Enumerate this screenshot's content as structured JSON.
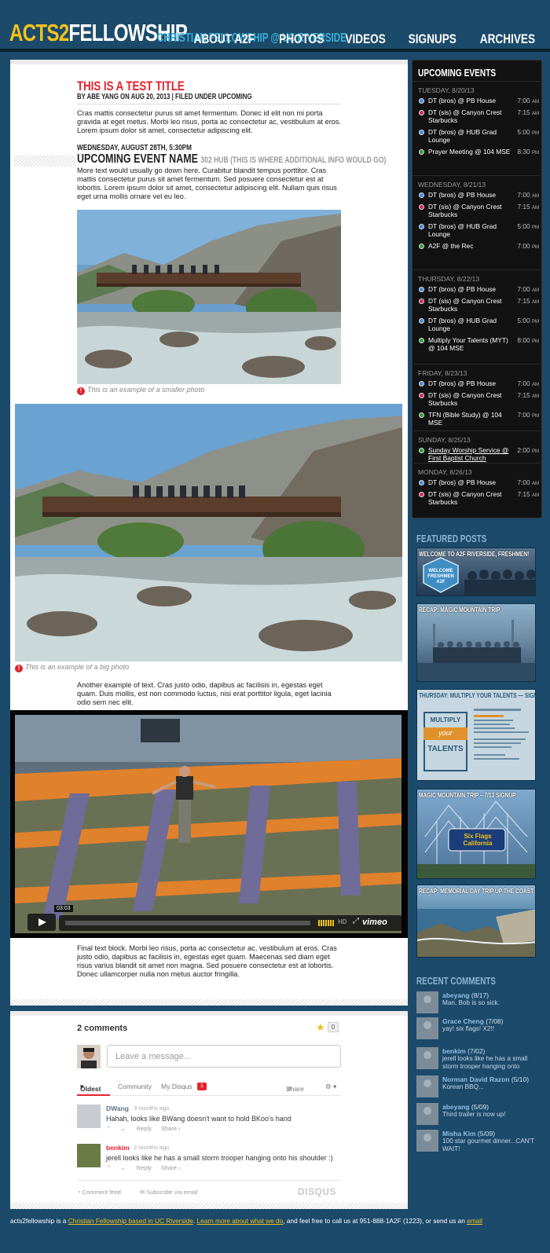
{
  "header": {
    "logo_part1": "ACTS2",
    "logo_part2": "FELLOWSHIP",
    "tagline": "CHRISTIAN FELLOWSHIP @ UC RIVERSIDE",
    "nav": [
      "ABOUT A2F",
      "PHOTOS",
      "VIDEOS",
      "SIGNUPS",
      "ARCHIVES"
    ]
  },
  "post": {
    "title": "THIS IS A TEST TITLE",
    "meta": "BY ABE YANG ON AUG 20, 2013 | FILED UNDER UPCOMING",
    "para1": "Cras mattis consectetur purus sit amet fermentum. Donec id elit non mi porta gravida at eget metus. Morbi leo risus, porta ac consectetur ac, vestibulum at eros. Lorem ipsum dolor sit amet, consectetur adipiscing elit.",
    "event_date": "WEDNESDAY, AUGUST 28TH, 5:30PM",
    "event_name": "UPCOMING EVENT NAME",
    "event_sub": "302 HUB (THIS IS WHERE ADDITIONAL INFO WOULD GO)",
    "para2": "More text would usually go down here. Curabitur blandit tempus porttitor. Cras mattis consectetur purus sit amet fermentum. Sed posuere consectetur est at lobortis. Lorem ipsum dolor sit amet, consectetur adipiscing elit. Nullam quis risus eget urna mollis ornare vel eu leo.",
    "caption_small": "This is an example of a smaller photo",
    "caption_big": "This is an example of a big photo",
    "para3": "Another example of text. Cras justo odio, dapibus ac facilisis in, egestas eget quam. Duis mollis, est non commodo luctus, nisi erat porttitor ligula, eget lacinia odio sem nec elit.",
    "video_time": "03:03",
    "video_brand": "vimeo",
    "video_hd": "HD",
    "para4": "Final text block. Morbi leo risus, porta ac consectetur ac, vestibulum at eros. Cras justo odio, dapibus ac facilisis in, egestas eget quam. Maecenas sed diam eget risus varius blandit sit amet non magna. Sed posuere consectetur est at lobortis. Donec ullamcorper nulla non metus auctor fringilla."
  },
  "comments": {
    "count_label": "2 comments",
    "star_count": "0",
    "placeholder": "Leave a message...",
    "tabs": {
      "oldest": "Oldest",
      "community": "Community",
      "mydisqus": "My Disqus",
      "mydisqus_badge": "1",
      "share": "Share"
    },
    "items": [
      {
        "author": "DWang",
        "time": "3 months ago",
        "text": "Hahah, looks like BWang doesn't want to hold BKoo's hand",
        "reply": "Reply",
        "share": "Share ›"
      },
      {
        "author": "benkim",
        "time": "2 months ago",
        "text": "jerell looks like he has a small storm trooper hanging onto his shoulder :)",
        "reply": "Reply",
        "share": "Share ›"
      }
    ],
    "feed": "Comment feed",
    "email": "Subscribe via email",
    "brand": "DISQUS"
  },
  "events": {
    "title": "UPCOMING EVENTS",
    "days": [
      {
        "label": "TUESDAY, 8/20/13",
        "items": [
          {
            "name": "DT (bros) @ PB House",
            "time": "7:00",
            "ampm": "AM",
            "color": "blue"
          },
          {
            "name": "DT (sis) @ Canyon Crest Starbucks",
            "time": "7:15",
            "ampm": "AM",
            "color": "pink"
          },
          {
            "name": "DT (bros) @ HUB Grad Lounge",
            "time": "5:00",
            "ampm": "PM",
            "color": "blue"
          },
          {
            "name": "Prayer Meeting @ 104 MSE",
            "time": "8:30",
            "ampm": "PM",
            "color": "green"
          }
        ]
      },
      {
        "label": "WEDNESDAY, 8/21/13",
        "items": [
          {
            "name": "DT (bros) @ PB House",
            "time": "7:00",
            "ampm": "AM",
            "color": "blue"
          },
          {
            "name": "DT (sis) @ Canyon Crest Starbucks",
            "time": "7:15",
            "ampm": "AM",
            "color": "pink"
          },
          {
            "name": "DT (bros) @ HUB Grad Lounge",
            "time": "5:00",
            "ampm": "PM",
            "color": "blue"
          },
          {
            "name": "A2F @ the Rec",
            "time": "7:00",
            "ampm": "PM",
            "color": "green"
          }
        ]
      },
      {
        "label": "THURSDAY, 8/22/13",
        "items": [
          {
            "name": "DT (bros) @ PB House",
            "time": "7:00",
            "ampm": "AM",
            "color": "blue"
          },
          {
            "name": "DT (sis) @ Canyon Crest Starbucks",
            "time": "7:15",
            "ampm": "AM",
            "color": "pink"
          },
          {
            "name": "DT (bros) @ HUB Grad Lounge",
            "time": "5:00",
            "ampm": "PM",
            "color": "blue"
          },
          {
            "name": "Multiply Your Talents (MYT) @ 104 MSE",
            "time": "8:00",
            "ampm": "PM",
            "color": "green"
          }
        ]
      },
      {
        "label": "FRIDAY, 8/23/13",
        "items": [
          {
            "name": "DT (bros) @ PB House",
            "time": "7:00",
            "ampm": "AM",
            "color": "blue"
          },
          {
            "name": "DT (sis) @ Canyon Crest Starbucks",
            "time": "7:15",
            "ampm": "AM",
            "color": "pink"
          },
          {
            "name": "TFN (Bible Study) @ 104 MSE",
            "time": "7:00",
            "ampm": "PM",
            "color": "green"
          }
        ]
      },
      {
        "label": "SUNDAY, 8/25/13",
        "items": [
          {
            "name": "Sunday Worship Service @ First Baptist Church",
            "time": "2:00",
            "ampm": "PM",
            "color": "green",
            "link": true
          }
        ]
      },
      {
        "label": "MONDAY, 8/26/13",
        "items": [
          {
            "name": "DT (bros) @ PB House",
            "time": "7:00",
            "ampm": "AM",
            "color": "blue"
          },
          {
            "name": "DT (sis) @ Canyon Crest Starbucks",
            "time": "7:15",
            "ampm": "AM",
            "color": "pink"
          }
        ]
      }
    ]
  },
  "featured": {
    "title": "FEATURED POSTS",
    "items": [
      "WELCOME TO A2F RIVERSIDE, FRESHMEN!",
      "RECAP: MAGIC MOUNTAIN TRIP",
      "THURSDAY: MULTIPLY YOUR TALENTS — SIGN UP",
      "MAGIC MOUNTAIN TRIP – 7/13 SIGNUP",
      "RECAP: MEMORIAL DAY TRIP UP THE COAST"
    ],
    "badge_text": "WELCOME FRESHMEN A2F",
    "myt_line1": "MULTIPLY",
    "myt_line2": "your",
    "myt_line3": "TALENTS",
    "sixflags": "Six Flags California"
  },
  "recent": {
    "title": "RECENT COMMENTS",
    "items": [
      {
        "name": "abeyang",
        "date": "(8/17)",
        "text": "Man, Bob is so sick."
      },
      {
        "name": "Grace Cheng",
        "date": "(7/08)",
        "text": "yay! six flags! X2!!"
      },
      {
        "name": "benkim",
        "date": "(7/02)",
        "text": "jerell looks like he has a small storm trooper hanging onto"
      },
      {
        "name": "Norman David Razon",
        "date": "(5/10)",
        "text": "Korean BBQ..."
      },
      {
        "name": "abeyang",
        "date": "(5/09)",
        "text": "Third trailer is now up!"
      },
      {
        "name": "Misha Kim",
        "date": "(5/09)",
        "text": "100 star gourmet dinner...CAN'T WAIT!"
      }
    ]
  },
  "footer": {
    "p1": "acts2fellowship is a ",
    "link1": "Christian Fellowship based in UC Riverside",
    "p2": ". ",
    "link2": "Learn more about what we do",
    "p3": ", and feel free to call us at 951-888-1A2F (1223), or send us an ",
    "link3": "email"
  },
  "colors": {
    "brand_yellow": "#f2c21b",
    "brand_blue": "#1b4a6a",
    "accent_red": "#e5212e",
    "tagline_blue": "#3ab0d9"
  }
}
